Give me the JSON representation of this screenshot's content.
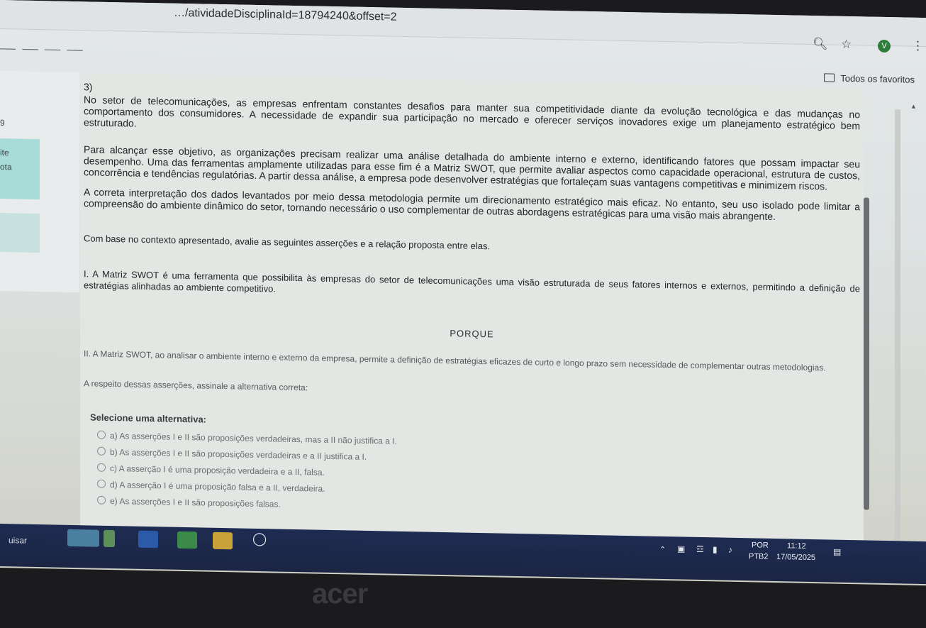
{
  "browser": {
    "url": "…/atividadeDisciplinaId=18794240&offset=2",
    "bookmark_folder": "Todos os favoritos",
    "avatar_letter": "V"
  },
  "left_panel": {
    "items": [
      "9",
      "ite",
      "ota"
    ]
  },
  "question": {
    "number": "3)",
    "para1": "No setor de telecomunicações, as empresas enfrentam constantes desafios para manter sua competitividade diante da evolução tecnológica e das mudanças no comportamento dos consumidores. A necessidade de expandir sua participação no mercado e oferecer serviços inovadores exige um planejamento estratégico bem estruturado.",
    "para2": "Para alcançar esse objetivo, as organizações precisam realizar uma análise detalhada do ambiente interno e externo, identificando fatores que possam impactar seu desempenho. Uma das ferramentas amplamente utilizadas para esse fim é a Matriz SWOT, que permite avaliar aspectos como capacidade operacional, estrutura de custos, concorrência e tendências regulatórias. A partir dessa análise, a empresa pode desenvolver estratégias que fortaleçam suas vantagens competitivas e minimizem riscos.",
    "para3": "A correta interpretação dos dados levantados por meio dessa metodologia permite um direcionamento estratégico mais eficaz. No entanto, seu uso isolado pode limitar a compreensão do ambiente dinâmico do setor, tornando necessário o uso complementar de outras abordagens estratégicas para uma visão mais abrangente.",
    "prompt": "Com base no contexto apresentado, avalie as seguintes asserções e a relação proposta entre elas.",
    "assertion1": "I. A Matriz SWOT é uma ferramenta que possibilita às empresas do setor de telecomunicações uma visão estruturada de seus fatores internos e externos, permitindo a definição de estratégias alinhadas ao ambiente competitivo.",
    "connector": "PORQUE",
    "assertion2": "II. A Matriz SWOT, ao analisar o ambiente interno e externo da empresa, permite a definição de estratégias eficazes de curto e longo prazo sem necessidade de complementar outras metodologias.",
    "instruction": "A respeito dessas asserções, assinale a alternativa correta:"
  },
  "options": {
    "title": "Selecione uma alternativa:",
    "items": [
      "a) As asserções I e II são proposições verdadeiras, mas a II não justifica a I.",
      "b) As asserções I e II são proposições verdadeiras e a II justifica a I.",
      "c) A asserção I é uma proposição verdadeira e a II, falsa.",
      "d) A asserção I é uma proposição falsa e a II, verdadeira.",
      "e) As asserções I e II são proposições falsas."
    ]
  },
  "taskbar": {
    "search_partial": "uisar",
    "lang_top": "POR",
    "lang_bottom": "PTB2",
    "time": "11:12",
    "date": "17/05/2025"
  },
  "bezel": {
    "brand": "acer"
  }
}
